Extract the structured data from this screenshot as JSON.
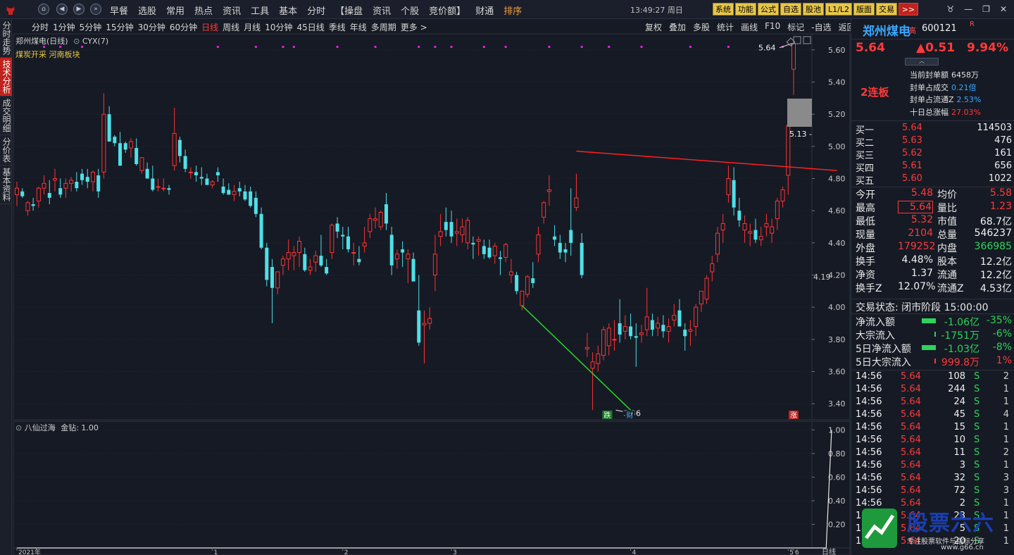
{
  "topbar": {
    "menus": [
      "早餐",
      "选股",
      "常用",
      "热点",
      "资讯",
      "工具",
      "基本",
      "分时",
      "【操盘",
      "资讯",
      "个股",
      "竞价额】",
      "财通",
      "排序"
    ],
    "clock": "13:49:27 周日",
    "buttons": [
      "系统",
      "功能",
      "公式",
      "自选",
      "股池",
      "L1/L2",
      "版面",
      "交易"
    ],
    "more": ">>"
  },
  "sidetabs": [
    "分时走势",
    "技术分析",
    "成交明细",
    "分价表",
    "基本资料"
  ],
  "periods": [
    "分时",
    "1分钟",
    "5分钟",
    "15分钟",
    "30分钟",
    "60分钟",
    "日线",
    "周线",
    "月线",
    "10分钟",
    "45日线",
    "季线",
    "年线",
    "多周期",
    "更多 >"
  ],
  "active_period": "日线",
  "tools": [
    "复权",
    "叠加",
    "多股",
    "统计",
    "画线",
    "F10",
    "标记",
    "-自选",
    "返回"
  ],
  "chart": {
    "title": "郑州煤电(日线)",
    "indicator": "CYX(7)",
    "blocks": "煤炭开采 河南板块",
    "y_ticks": [
      "5.60",
      "5.40",
      "5.20",
      "5.00",
      "4.80",
      "4.60",
      "4.40",
      "4.20",
      "4.00",
      "3.80",
      "3.60",
      "3.40"
    ],
    "current_marker": "4.19",
    "high_label": "5.64",
    "low_label": "3.36",
    "side_label": "5.13",
    "tag_die": "跌",
    "tag_cai": "财",
    "tag_zhang": "涨",
    "x_labels": [
      "2021年",
      "1",
      "2",
      "3",
      "4",
      "5",
      "6"
    ]
  },
  "sub_chart": {
    "title": "八仙过海",
    "value_label": "金钻: 1.00",
    "y_ticks": [
      "1.00",
      "0.80",
      "0.60",
      "0.40",
      "0.20"
    ],
    "x_last": "日线"
  },
  "stock": {
    "name": "郑州煤电",
    "flag": "高",
    "code": "600121",
    "r_mark": "R",
    "price": "5.64",
    "change": "▲0.51",
    "change_pct": "9.94%",
    "collapse": "︿"
  },
  "seal": {
    "lianban": "2连板",
    "rows": [
      {
        "label": "当前封单额",
        "value": "6458万",
        "cls": ""
      },
      {
        "label": "封单占成交",
        "value": "0.21倍",
        "cls": "v"
      },
      {
        "label": "封单占流通Z",
        "value": "2.53%",
        "cls": "v"
      },
      {
        "label": "十日总涨幅",
        "value": "27.03%",
        "cls": "vr"
      }
    ]
  },
  "orderbook": [
    {
      "label": "买一",
      "price": "5.64",
      "qty": "114503"
    },
    {
      "label": "买二",
      "price": "5.63",
      "qty": "476"
    },
    {
      "label": "买三",
      "price": "5.62",
      "qty": "161"
    },
    {
      "label": "买四",
      "price": "5.61",
      "qty": "656"
    },
    {
      "label": "买五",
      "price": "5.60",
      "qty": "1022"
    }
  ],
  "stats": [
    {
      "l1": "今开",
      "v1": "5.48",
      "c1": "#ff3a3a",
      "l2": "均价",
      "v2": "5.58",
      "c2": "#ff3a3a"
    },
    {
      "l1": "最高",
      "v1": "5.64",
      "c1": "#ff3a3a",
      "l2": "量比",
      "v2": "1.23",
      "c2": "#ff3a3a"
    },
    {
      "l1": "最低",
      "v1": "5.32",
      "c1": "#ff3a3a",
      "l2": "市值",
      "v2": "68.7亿",
      "c2": "#f0f0f0"
    },
    {
      "l1": "现量",
      "v1": "2104",
      "c1": "#ff3a3a",
      "l2": "总量",
      "v2": "546237",
      "c2": "#f0f0f0"
    },
    {
      "l1": "外盘",
      "v1": "179252",
      "c1": "#ff3a3a",
      "l2": "内盘",
      "v2": "366985",
      "c2": "#2fd35c"
    },
    {
      "l1": "换手",
      "v1": "4.48%",
      "c1": "#f0f0f0",
      "l2": "股本",
      "v2": "12.2亿",
      "c2": "#f0f0f0"
    },
    {
      "l1": "净资",
      "v1": "1.37",
      "c1": "#f0f0f0",
      "l2": "流通",
      "v2": "12.2亿",
      "c2": "#f0f0f0"
    },
    {
      "l1": "换手Z",
      "v1": "12.07%",
      "c1": "#f0f0f0",
      "l2": "流通Z",
      "v2": "4.53亿",
      "c2": "#f0f0f0"
    }
  ],
  "trade_status": "交易状态: 闭市阶段 15:00:00",
  "flows": [
    {
      "label": "净流入额",
      "value": "-1.06亿",
      "pct": "-35%",
      "color": "#2fd35c",
      "bar": 0.9
    },
    {
      "label": "大宗流入",
      "value": "-1751万",
      "pct": "-6%",
      "color": "#2fd35c",
      "bar": 0.1
    },
    {
      "label": "5日净流入额",
      "value": "-1.03亿",
      "pct": "-8%",
      "color": "#2fd35c",
      "bar": 0.9
    },
    {
      "label": "5日大宗流入",
      "value": "999.8万",
      "pct": "1%",
      "color": "#ff3a3a",
      "bar": 0.05
    }
  ],
  "ticks": [
    {
      "t": "14:56",
      "p": "5.64",
      "q": "108",
      "s": "S",
      "n": "2"
    },
    {
      "t": "14:56",
      "p": "5.64",
      "q": "244",
      "s": "S",
      "n": "1"
    },
    {
      "t": "14:56",
      "p": "5.64",
      "q": "24",
      "s": "S",
      "n": "1"
    },
    {
      "t": "14:56",
      "p": "5.64",
      "q": "45",
      "s": "S",
      "n": "4"
    },
    {
      "t": "14:56",
      "p": "5.64",
      "q": "15",
      "s": "S",
      "n": "1"
    },
    {
      "t": "14:56",
      "p": "5.64",
      "q": "10",
      "s": "S",
      "n": "1"
    },
    {
      "t": "14:56",
      "p": "5.64",
      "q": "11",
      "s": "S",
      "n": "2"
    },
    {
      "t": "14:56",
      "p": "5.64",
      "q": "3",
      "s": "S",
      "n": "1"
    },
    {
      "t": "14:56",
      "p": "5.64",
      "q": "32",
      "s": "S",
      "n": "3"
    },
    {
      "t": "14:56",
      "p": "5.64",
      "q": "72",
      "s": "S",
      "n": "3"
    },
    {
      "t": "14:56",
      "p": "5.64",
      "q": "2",
      "s": "S",
      "n": "1"
    },
    {
      "t": "14:56",
      "p": "5.64",
      "q": "23",
      "s": "S",
      "n": "1"
    },
    {
      "t": "14:56",
      "p": "5.64",
      "q": "5",
      "s": "S",
      "n": "1"
    },
    {
      "t": "14:56",
      "p": "5.64",
      "q": "20",
      "s": "S",
      "n": "1"
    }
  ],
  "watermark": {
    "text": "股票六六",
    "sub": "专注股票软件与指标分享",
    "url": "www.g66.cn"
  },
  "chart_data": {
    "type": "candlestick",
    "title": "郑州煤电(日线)",
    "ylim": [
      3.3,
      5.7
    ],
    "x_labels": [
      "2021年",
      "1",
      "2",
      "3",
      "4",
      "5",
      "6"
    ],
    "ohlc": [
      [
        4.7,
        4.78,
        4.63,
        4.74
      ],
      [
        4.72,
        4.74,
        4.68,
        4.69
      ],
      [
        4.6,
        4.66,
        4.57,
        4.65
      ],
      [
        4.64,
        4.68,
        4.6,
        4.63
      ],
      [
        4.66,
        4.75,
        4.62,
        4.74
      ],
      [
        4.74,
        4.82,
        4.7,
        4.77
      ],
      [
        4.71,
        4.79,
        4.64,
        4.68
      ],
      [
        4.79,
        4.86,
        4.72,
        4.8
      ],
      [
        4.74,
        4.8,
        4.68,
        4.7
      ],
      [
        4.74,
        4.8,
        4.68,
        4.77
      ],
      [
        4.77,
        4.81,
        4.72,
        4.79
      ],
      [
        4.78,
        4.84,
        4.72,
        4.74
      ],
      [
        4.83,
        4.86,
        4.76,
        4.79
      ],
      [
        4.81,
        4.86,
        4.74,
        4.78
      ],
      [
        4.78,
        4.85,
        4.72,
        4.84
      ],
      [
        4.82,
        4.86,
        4.68,
        4.72
      ],
      [
        4.84,
        5.33,
        4.8,
        5.2
      ],
      [
        5.2,
        5.25,
        5.03,
        5.03
      ],
      [
        5.06,
        5.07,
        5.0,
        5.02
      ],
      [
        5.02,
        5.09,
        4.88,
        4.88
      ],
      [
        5.02,
        5.03,
        4.96,
        4.98
      ],
      [
        4.99,
        5.05,
        4.93,
        5.03
      ],
      [
        4.99,
        5.05,
        4.88,
        4.89
      ],
      [
        4.85,
        4.93,
        4.83,
        4.93
      ],
      [
        4.86,
        4.9,
        4.8,
        4.8
      ],
      [
        4.8,
        4.88,
        4.72,
        4.73
      ],
      [
        4.75,
        4.8,
        4.72,
        4.75
      ],
      [
        4.74,
        4.8,
        4.72,
        4.74
      ],
      [
        4.74,
        4.76,
        4.7,
        4.73
      ],
      [
        4.88,
        5.24,
        4.85,
        5.08
      ],
      [
        5.04,
        5.06,
        4.9,
        4.94
      ],
      [
        4.94,
        4.98,
        4.84,
        4.86
      ],
      [
        4.84,
        4.87,
        4.8,
        4.84
      ],
      [
        4.84,
        4.88,
        4.78,
        4.82
      ],
      [
        4.81,
        4.87,
        4.76,
        4.8
      ],
      [
        4.8,
        4.83,
        4.76,
        4.76
      ],
      [
        4.76,
        4.79,
        4.74,
        4.78
      ],
      [
        4.84,
        4.87,
        4.78,
        4.82
      ],
      [
        4.75,
        4.8,
        4.7,
        4.71
      ],
      [
        4.73,
        4.77,
        4.7,
        4.7
      ],
      [
        4.7,
        4.76,
        4.66,
        4.72
      ],
      [
        4.74,
        4.78,
        4.69,
        4.72
      ],
      [
        4.72,
        4.76,
        4.66,
        4.67
      ],
      [
        4.72,
        4.75,
        4.62,
        4.63
      ],
      [
        4.68,
        4.72,
        4.56,
        4.58
      ],
      [
        4.58,
        4.62,
        4.36,
        4.37
      ],
      [
        4.37,
        4.4,
        4.13,
        4.17
      ],
      [
        4.25,
        4.3,
        3.9,
        4.12
      ],
      [
        4.12,
        4.22,
        4.08,
        4.22
      ],
      [
        4.26,
        4.32,
        4.2,
        4.3
      ],
      [
        4.3,
        4.42,
        4.23,
        4.34
      ],
      [
        4.32,
        4.38,
        4.23,
        4.34
      ],
      [
        4.34,
        4.44,
        4.25,
        4.41
      ],
      [
        4.33,
        4.37,
        4.22,
        4.23
      ],
      [
        4.23,
        4.3,
        4.2,
        4.25
      ],
      [
        4.28,
        4.35,
        4.22,
        4.32
      ],
      [
        4.32,
        4.45,
        4.25,
        4.26
      ],
      [
        4.25,
        4.3,
        4.2,
        4.21
      ],
      [
        4.34,
        4.52,
        4.3,
        4.51
      ],
      [
        4.52,
        4.56,
        4.43,
        4.47
      ],
      [
        4.45,
        4.5,
        4.36,
        4.44
      ],
      [
        4.44,
        4.5,
        4.34,
        4.36
      ],
      [
        4.34,
        4.4,
        4.26,
        4.34
      ],
      [
        4.3,
        4.38,
        4.26,
        4.28
      ],
      [
        4.38,
        4.5,
        4.34,
        4.4
      ],
      [
        4.47,
        4.58,
        4.43,
        4.55
      ],
      [
        4.54,
        4.62,
        4.49,
        4.55
      ],
      [
        4.5,
        4.6,
        4.48,
        4.59
      ],
      [
        4.64,
        4.71,
        4.48,
        4.52
      ],
      [
        4.45,
        4.5,
        4.2,
        4.26
      ],
      [
        4.3,
        4.36,
        4.24,
        4.33
      ],
      [
        4.36,
        4.41,
        4.25,
        4.34
      ],
      [
        4.3,
        4.36,
        4.15,
        4.33
      ],
      [
        4.3,
        4.34,
        4.2,
        4.16
      ],
      [
        3.98,
        4.2,
        3.76,
        3.78
      ],
      [
        3.89,
        3.98,
        3.65,
        3.9
      ],
      [
        3.9,
        4.0,
        3.86,
        3.93
      ],
      [
        4.2,
        4.45,
        4.1,
        4.33
      ],
      [
        4.44,
        4.58,
        4.38,
        4.47
      ],
      [
        4.53,
        4.62,
        4.44,
        4.48
      ],
      [
        4.53,
        4.6,
        4.4,
        4.44
      ],
      [
        4.46,
        4.55,
        4.38,
        4.47
      ],
      [
        4.45,
        4.55,
        4.4,
        4.5
      ],
      [
        4.4,
        4.56,
        4.36,
        4.54
      ],
      [
        4.4,
        4.44,
        4.3,
        4.39
      ],
      [
        4.41,
        4.44,
        4.32,
        4.42
      ],
      [
        4.38,
        4.42,
        4.3,
        4.33
      ],
      [
        4.37,
        4.42,
        4.3,
        4.31
      ],
      [
        4.32,
        4.4,
        4.27,
        4.38
      ],
      [
        4.31,
        4.35,
        4.2,
        4.3
      ],
      [
        4.31,
        4.4,
        4.28,
        4.39
      ],
      [
        4.2,
        4.3,
        4.15,
        4.22
      ],
      [
        4.2,
        4.22,
        4.08,
        4.1
      ],
      [
        4.01,
        4.1,
        3.98,
        4.1
      ],
      [
        4.08,
        4.2,
        4.06,
        4.19
      ],
      [
        4.18,
        4.28,
        4.12,
        4.15
      ],
      [
        4.33,
        4.5,
        4.28,
        4.45
      ],
      [
        4.56,
        4.66,
        4.52,
        4.65
      ],
      [
        4.72,
        4.82,
        4.63,
        4.73
      ],
      [
        4.44,
        4.51,
        4.38,
        4.42
      ],
      [
        4.4,
        4.45,
        4.3,
        4.34
      ],
      [
        4.36,
        4.4,
        4.28,
        4.34
      ],
      [
        4.48,
        4.74,
        4.32,
        4.4
      ],
      [
        4.62,
        4.83,
        4.6,
        4.68
      ],
      [
        4.4,
        4.46,
        4.18,
        4.2
      ],
      [
        3.74,
        3.84,
        3.69,
        3.75
      ],
      [
        3.62,
        3.72,
        3.36,
        3.66
      ],
      [
        3.65,
        3.76,
        3.6,
        3.71
      ],
      [
        3.7,
        3.88,
        3.67,
        3.86
      ],
      [
        3.76,
        3.9,
        3.7,
        3.87
      ],
      [
        3.8,
        3.92,
        3.73,
        3.8
      ],
      [
        3.9,
        4.05,
        3.78,
        3.83
      ],
      [
        3.85,
        3.95,
        3.8,
        3.88
      ],
      [
        3.88,
        3.96,
        3.8,
        3.82
      ],
      [
        3.82,
        3.9,
        3.63,
        3.81
      ],
      [
        3.83,
        3.89,
        3.78,
        3.84
      ],
      [
        3.86,
        4.12,
        3.82,
        3.94
      ],
      [
        3.92,
        3.96,
        3.82,
        3.86
      ],
      [
        3.87,
        3.94,
        3.82,
        3.9
      ],
      [
        3.89,
        3.95,
        3.81,
        3.85
      ],
      [
        3.85,
        3.93,
        3.78,
        3.88
      ],
      [
        3.92,
        4.02,
        3.88,
        3.95
      ],
      [
        3.98,
        4.05,
        3.9,
        3.88
      ],
      [
        3.86,
        3.9,
        3.73,
        3.82
      ],
      [
        3.85,
        3.92,
        3.76,
        3.86
      ],
      [
        3.88,
        4.02,
        3.82,
        4.0
      ],
      [
        4.02,
        4.1,
        3.97,
        4.1
      ],
      [
        4.05,
        4.2,
        4.02,
        4.18
      ],
      [
        4.22,
        4.32,
        4.16,
        4.27
      ],
      [
        4.33,
        4.5,
        4.28,
        4.46
      ],
      [
        4.48,
        4.58,
        4.4,
        4.52
      ],
      [
        4.7,
        4.88,
        4.65,
        4.8
      ],
      [
        4.79,
        4.87,
        4.57,
        4.62
      ],
      [
        4.6,
        4.68,
        4.5,
        4.54
      ],
      [
        4.48,
        4.57,
        4.4,
        4.52
      ],
      [
        4.46,
        4.52,
        4.38,
        4.47
      ],
      [
        4.48,
        4.55,
        4.4,
        4.42
      ],
      [
        4.42,
        4.5,
        4.38,
        4.44
      ],
      [
        4.5,
        4.58,
        4.44,
        4.52
      ],
      [
        4.46,
        4.55,
        4.4,
        4.5
      ],
      [
        4.55,
        4.68,
        4.48,
        4.66
      ],
      [
        4.66,
        4.75,
        4.62,
        4.73
      ],
      [
        4.82,
        5.13,
        4.7,
        5.13
      ],
      [
        5.48,
        5.64,
        5.32,
        5.64
      ]
    ],
    "trend_lines": [
      {
        "color": "#ff2020",
        "from_index": 103,
        "from_price": 4.97,
        "to_index": 151,
        "to_price": 4.85
      },
      {
        "color": "#28d828",
        "from_index": 93,
        "from_price": 4.01,
        "to_index": 113,
        "to_price": 3.36
      }
    ],
    "sub_values": [
      0,
      0,
      0,
      0,
      0,
      0,
      0,
      0,
      0,
      0,
      0,
      0,
      0,
      0,
      0,
      0,
      0,
      0,
      0,
      0,
      0,
      0,
      0,
      0,
      0,
      0,
      0,
      0,
      0,
      0,
      0,
      0,
      0,
      0,
      0,
      0,
      0,
      0,
      0,
      0,
      0,
      0,
      0,
      0,
      0,
      0,
      0,
      0,
      0,
      0,
      0,
      0,
      0,
      0,
      0,
      0,
      0,
      0,
      0,
      0,
      0,
      0,
      0,
      0,
      0,
      0,
      0,
      0,
      0,
      0,
      0,
      0,
      0,
      0,
      0,
      0,
      0,
      0,
      0,
      0,
      0,
      0,
      0,
      0,
      0,
      0,
      0,
      0,
      0,
      0,
      0,
      0,
      0,
      0,
      0,
      0,
      0,
      0,
      0,
      0,
      0,
      0,
      0,
      0,
      0,
      0,
      0,
      0,
      0,
      0,
      0,
      0,
      0,
      0,
      0,
      0,
      0,
      0,
      0,
      0,
      0,
      0,
      0,
      0,
      0,
      0,
      0,
      0,
      0,
      0,
      0,
      0,
      0,
      0,
      0,
      0,
      0,
      0,
      0,
      0,
      0,
      0,
      0,
      0,
      0,
      0,
      0,
      0,
      0,
      0,
      1.0
    ],
    "sub_ylim": [
      0,
      1.05
    ]
  }
}
